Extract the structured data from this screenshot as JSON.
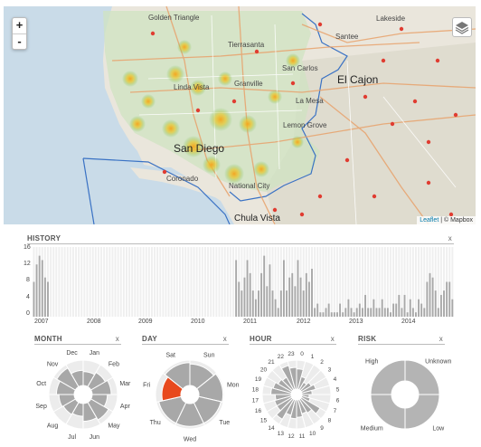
{
  "map": {
    "zoom_in": "+",
    "zoom_out": "-",
    "attribution_leaflet": "Leaflet",
    "attribution_rest": " | © Mapbox",
    "places": [
      {
        "name": "Golden Triangle",
        "cls": ""
      },
      {
        "name": "Tierrasanta",
        "cls": ""
      },
      {
        "name": "Santee",
        "cls": ""
      },
      {
        "name": "Lakeside",
        "cls": ""
      },
      {
        "name": "San Carlos",
        "cls": ""
      },
      {
        "name": "El Cajon",
        "cls": "big"
      },
      {
        "name": "Linda Vista",
        "cls": ""
      },
      {
        "name": "Granville",
        "cls": ""
      },
      {
        "name": "La Mesa",
        "cls": ""
      },
      {
        "name": "Lemon Grove",
        "cls": ""
      },
      {
        "name": "San Diego",
        "cls": "big"
      },
      {
        "name": "Coronado",
        "cls": ""
      },
      {
        "name": "National City",
        "cls": ""
      },
      {
        "name": "Chula Vista",
        "cls": "mid"
      }
    ]
  },
  "history": {
    "title": "HISTORY",
    "close": "x",
    "y_ticks": [
      "16",
      "12",
      "8",
      "4",
      "0"
    ],
    "x_ticks": [
      "2007",
      "2008",
      "2009",
      "2010",
      "2011",
      "2012",
      "2013",
      "2014"
    ]
  },
  "month": {
    "title": "MONTH",
    "close": "x",
    "labels": [
      "Jan",
      "Feb",
      "Mar",
      "Apr",
      "May",
      "Jun",
      "Jul",
      "Aug",
      "Sep",
      "Oct",
      "Nov",
      "Dec"
    ]
  },
  "day": {
    "title": "DAY",
    "close": "x",
    "labels": [
      "Sun",
      "Mon",
      "Tue",
      "Wed",
      "Thu",
      "Fri",
      "Sat"
    ]
  },
  "hour": {
    "title": "HOUR",
    "close": "x",
    "labels": [
      "0",
      "1",
      "2",
      "3",
      "4",
      "5",
      "6",
      "7",
      "8",
      "9",
      "10",
      "11",
      "12",
      "13",
      "14",
      "15",
      "16",
      "17",
      "18",
      "19",
      "20",
      "21",
      "22",
      "23"
    ]
  },
  "risk": {
    "title": "RISK",
    "close": "x",
    "labels": [
      "Unknown",
      "Low",
      "Medium",
      "High"
    ]
  },
  "chart_data": [
    {
      "type": "bar",
      "title": "HISTORY",
      "ylim": [
        0,
        16
      ],
      "x": [
        "2007",
        "2008",
        "2009",
        "2010",
        "2011",
        "2012",
        "2013",
        "2014"
      ],
      "values": [
        8,
        12,
        14,
        13,
        9,
        8,
        0,
        0,
        0,
        0,
        0,
        0,
        0,
        0,
        0,
        0,
        0,
        0,
        0,
        0,
        0,
        0,
        0,
        0,
        0,
        0,
        0,
        0,
        0,
        0,
        0,
        0,
        0,
        0,
        0,
        0,
        0,
        0,
        0,
        0,
        0,
        0,
        0,
        0,
        0,
        0,
        0,
        0,
        0,
        0,
        0,
        0,
        0,
        0,
        0,
        0,
        0,
        0,
        0,
        0,
        0,
        0,
        0,
        0,
        0,
        0,
        0,
        0,
        0,
        0,
        0,
        0,
        13,
        8,
        6,
        9,
        13,
        10,
        6,
        4,
        6,
        10,
        14,
        7,
        12,
        6,
        4,
        2,
        6,
        13,
        6,
        9,
        10,
        7,
        13,
        9,
        6,
        10,
        8,
        11,
        2,
        3,
        1,
        1,
        2,
        3,
        1,
        1,
        1,
        3,
        1,
        2,
        4,
        2,
        1,
        2,
        3,
        2,
        5,
        2,
        2,
        4,
        2,
        2,
        4,
        2,
        2,
        1,
        3,
        3,
        5,
        2,
        5,
        1,
        4,
        2,
        1,
        4,
        3,
        2,
        8,
        10,
        9,
        6,
        2,
        5,
        6,
        8,
        8,
        4
      ]
    },
    {
      "type": "radial",
      "title": "MONTH",
      "categories": [
        "Jan",
        "Feb",
        "Mar",
        "Apr",
        "May",
        "Jun",
        "Jul",
        "Aug",
        "Sep",
        "Oct",
        "Nov",
        "Dec"
      ],
      "values": [
        0.55,
        0.65,
        0.75,
        0.6,
        0.8,
        0.7,
        0.5,
        0.55,
        0.6,
        0.7,
        0.85,
        0.6
      ]
    },
    {
      "type": "radial",
      "title": "DAY",
      "categories": [
        "Sun",
        "Mon",
        "Tue",
        "Wed",
        "Thu",
        "Fri",
        "Sat"
      ],
      "values": [
        0.85,
        0.95,
        0.9,
        0.9,
        0.9,
        0.75,
        0.9
      ],
      "highlight": "Fri",
      "highlight_color": "#e8491d"
    },
    {
      "type": "radial",
      "title": "HOUR",
      "categories": [
        "0",
        "1",
        "2",
        "3",
        "4",
        "5",
        "6",
        "7",
        "8",
        "9",
        "10",
        "11",
        "12",
        "13",
        "14",
        "15",
        "16",
        "17",
        "18",
        "19",
        "20",
        "21",
        "22",
        "23"
      ],
      "values": [
        0.7,
        0.45,
        0.3,
        0.4,
        0.5,
        0.35,
        0.25,
        0.3,
        0.75,
        0.55,
        0.5,
        0.6,
        0.65,
        0.55,
        0.8,
        0.6,
        0.6,
        0.55,
        0.7,
        0.65,
        0.55,
        0.5,
        0.85,
        0.75
      ]
    },
    {
      "type": "radial",
      "title": "RISK",
      "categories": [
        "Unknown",
        "Low",
        "Medium",
        "High"
      ],
      "values": [
        1,
        1,
        1,
        1
      ]
    }
  ]
}
